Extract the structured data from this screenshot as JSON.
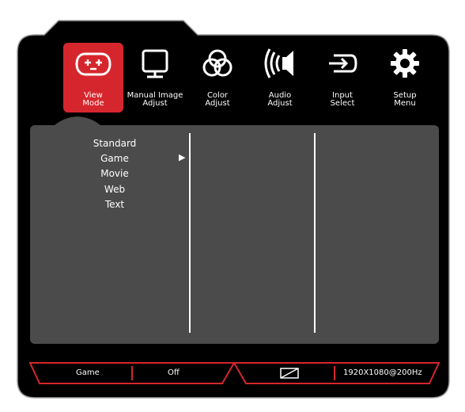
{
  "tabs": [
    {
      "id": "view-mode",
      "line1": "View",
      "line2": "Mode",
      "icon": "gamepad-icon",
      "active": true
    },
    {
      "id": "manual-image-adjust",
      "line1": "Manual Image",
      "line2": "Adjust",
      "icon": "monitor-icon",
      "active": false
    },
    {
      "id": "color-adjust",
      "line1": "Color",
      "line2": "Adjust",
      "icon": "color-circles-icon",
      "active": false
    },
    {
      "id": "audio-adjust",
      "line1": "Audio",
      "line2": "Adjust",
      "icon": "speaker-icon",
      "active": false
    },
    {
      "id": "input-select",
      "line1": "Input",
      "line2": "Select",
      "icon": "input-arrow-icon",
      "active": false
    },
    {
      "id": "setup-menu",
      "line1": "Setup",
      "line2": "Menu",
      "icon": "gear-icon",
      "active": false
    }
  ],
  "view_mode_options": [
    "Standard",
    "Game",
    "Movie",
    "Web",
    "Text"
  ],
  "selected_option": "Game",
  "selector_glyph": "▶",
  "status_bar": {
    "mode": "Game",
    "setting": "Off",
    "signal_icon": "aspect-ratio-icon",
    "resolution": "1920X1080@200Hz"
  },
  "colors": {
    "accent": "#d6262d",
    "frame": "#000000",
    "panel": "#4b4b4b",
    "text": "#ffffff"
  }
}
